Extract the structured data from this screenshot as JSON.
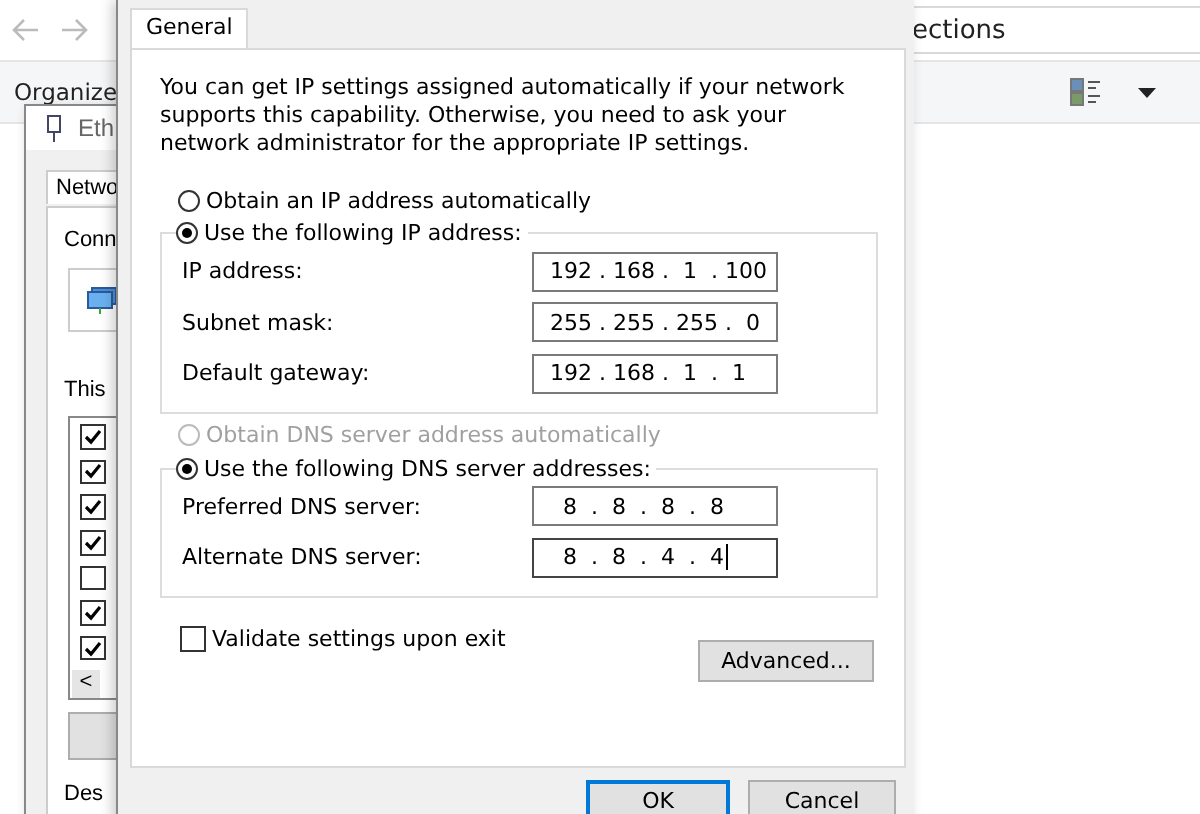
{
  "explorer": {
    "address_text": "ections",
    "toolbar": {
      "organize": "Organize"
    }
  },
  "properties_window": {
    "title": "Eth",
    "tab": "Netwo",
    "connect_label": "Conn",
    "list_label": "This",
    "items": [
      {
        "checked": true
      },
      {
        "checked": true
      },
      {
        "checked": true
      },
      {
        "checked": true
      },
      {
        "checked": false
      },
      {
        "checked": true
      },
      {
        "checked": true
      }
    ],
    "scroll_left": "<",
    "description_label": "Des"
  },
  "dialog": {
    "tabs": [
      {
        "label": "General",
        "selected": true
      }
    ],
    "intro": "You can get IP settings assigned automatically if your network supports this capability. Otherwise, you need to ask your network administrator for the appropriate IP settings.",
    "ip_options": [
      {
        "label": "Obtain an IP address automatically",
        "selected": false,
        "disabled": false
      },
      {
        "label": "Use the following IP address:",
        "selected": true,
        "disabled": false
      }
    ],
    "ip_fields": [
      {
        "label": "IP address:",
        "value": "192 . 168 .  1  . 100"
      },
      {
        "label": "Subnet mask:",
        "value": "255 . 255 . 255 .  0"
      },
      {
        "label": "Default gateway:",
        "value": "192 . 168 .  1  .  1"
      }
    ],
    "dns_options": [
      {
        "label": "Obtain DNS server address automatically",
        "selected": false,
        "disabled": true
      },
      {
        "label": "Use the following DNS server addresses:",
        "selected": true,
        "disabled": false
      }
    ],
    "dns_fields": [
      {
        "label": "Preferred DNS server:",
        "value": " 8  .  8  .  8  .  8",
        "focused": false
      },
      {
        "label": "Alternate DNS server:",
        "value": " 8  .  8  .  4  .  4",
        "focused": true
      }
    ],
    "validate": {
      "label": "Validate settings upon exit",
      "checked": false
    },
    "advanced_button": "Advanced...",
    "buttons": [
      {
        "label": "OK",
        "default": true
      },
      {
        "label": "Cancel",
        "default": false
      }
    ]
  }
}
